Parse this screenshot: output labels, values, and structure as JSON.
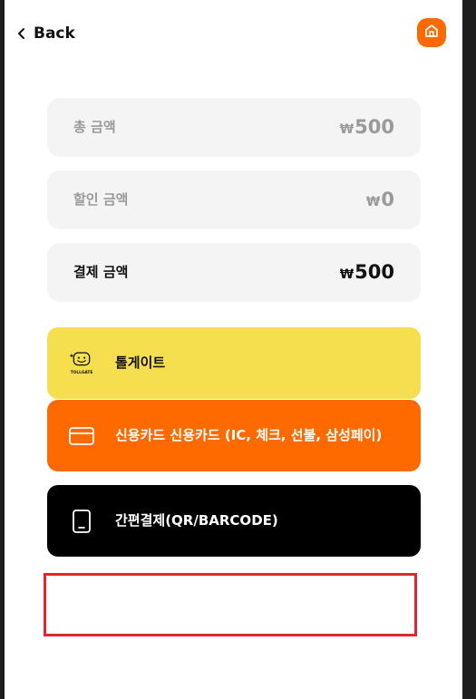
{
  "header": {
    "back_label": "Back",
    "back_icon": "chevron-left-icon",
    "home_icon": "home-icon",
    "accent_color": "#ff6a00"
  },
  "summary": {
    "currency_symbol": "₩",
    "total": {
      "label": "총 금액",
      "amount": "500"
    },
    "discount": {
      "label": "할인 금액",
      "amount": "0"
    },
    "payment": {
      "label": "결제 금액",
      "amount": "500"
    }
  },
  "payment_methods": {
    "tollgate": {
      "label": "톨게이트",
      "logo_text": "TOLLGATE",
      "icon": "tollgate-logo",
      "color": "#f6df4e"
    },
    "credit_card": {
      "label": "신용카드 신용카드 (IC, 체크, 선불, 삼성페이)",
      "icon": "credit-card-icon",
      "color": "#ff6a00"
    },
    "simple_pay": {
      "label": "간편결제(QR/BARCODE)",
      "icon": "mobile-phone-icon",
      "color": "#000000"
    }
  },
  "highlight_color": "#e3262e"
}
